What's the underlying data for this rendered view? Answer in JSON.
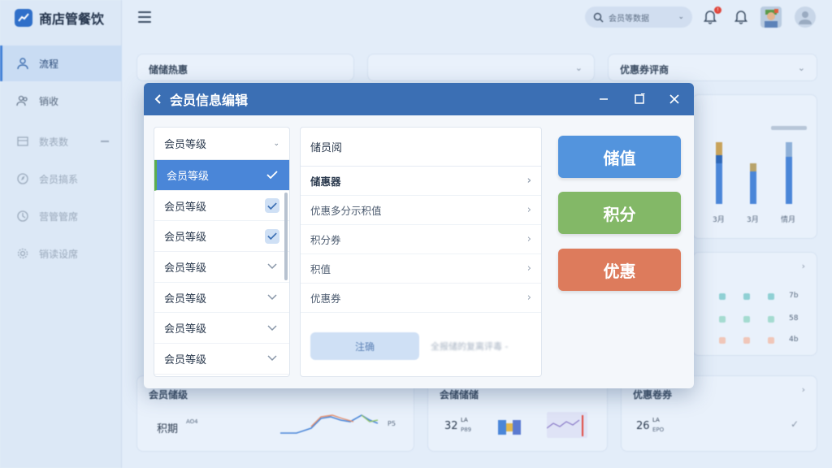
{
  "app": {
    "title": "商店管餐饮",
    "sidebar": [
      {
        "label": "流程",
        "active": true
      },
      {
        "label": "销收",
        "active": false
      },
      {
        "label": "数表数",
        "active": false
      },
      {
        "label": "会员搞系",
        "active": false
      },
      {
        "label": "营管管席",
        "active": false
      },
      {
        "label": "销读设席",
        "active": false
      }
    ],
    "search_placeholder": "会员等数据"
  },
  "cards": {
    "c1_title": "储储热惠",
    "c3_title": "优惠券评商",
    "bottom1_title": "会员储级",
    "bottom1_label": "积期",
    "bottom1_sup": "AO4",
    "bottom1_tag": "P5",
    "bottom2_title": "会储储储",
    "bottom2_value": "32",
    "bottom2_sup": "LA",
    "bottom2_sub": "P89",
    "bottom3_title": "优惠卷券",
    "bottom3_value": "26",
    "bottom3_sup": "LA",
    "bottom3_sub": "EPO",
    "chart_months": [
      "3月",
      "3月",
      "情月"
    ],
    "mini_table_values": [
      "7b",
      "58",
      "4b"
    ]
  },
  "modal": {
    "title": "会员信息编辑",
    "level_header": "会员等级",
    "levels": [
      "会员等级",
      "会员等级",
      "会员等级",
      "会员等级",
      "会员等级",
      "会员等级",
      "会员等级"
    ],
    "info_header": "储员阅",
    "info_rows": [
      "储惠器",
      "优惠多分示积值",
      "积分券",
      "积值",
      "优惠券"
    ],
    "confirm_label": "注确",
    "hint_text": "全报储的复离评毒 -",
    "btn_store": "储值",
    "btn_points": "积分",
    "btn_discount": "优惠"
  },
  "colors": {
    "header": "#3b6fb4",
    "selected_row": "#4a86d8",
    "store_btn": "#5394dd",
    "points_btn": "#83b867",
    "discount_btn": "#dd7b5c"
  }
}
